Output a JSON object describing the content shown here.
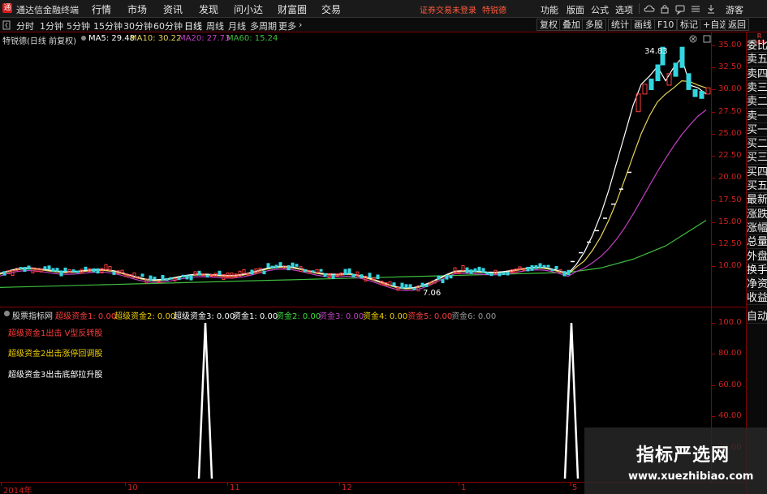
{
  "app": {
    "title": "通达信金融终端",
    "logo_char": "通"
  },
  "menu": [
    "行情",
    "市场",
    "资讯",
    "发现",
    "问小达",
    "财富圈",
    "交易"
  ],
  "status": {
    "trade_login": "证券交易未登录",
    "stock_name": "特锐德"
  },
  "right_menu": [
    "功能",
    "版面",
    "公式",
    "选项",
    "游客"
  ],
  "toolbar": {
    "periods": [
      "分时",
      "1分钟",
      "5分钟",
      "15分钟",
      "30分钟",
      "60分钟",
      "日线",
      "周线",
      "月线",
      "多周期",
      "更多"
    ],
    "active": "日线",
    "more_arrow": "›",
    "right_buttons": [
      "复权",
      "叠加",
      "多股",
      "统计",
      "画线",
      "F10",
      "标记",
      "+自选",
      "返回"
    ]
  },
  "chart_header": {
    "stock_label": "特锐德(日线 前复权)",
    "ma5_label": "MA5: 29.48",
    "ma10_label": "MA10: 30.22",
    "ma20_label": "MA20: 27.73",
    "ma60_label": "MA60: 15.24"
  },
  "colors": {
    "ma5": "#ffffff",
    "ma10": "#e8d35a",
    "ma20": "#c340c3",
    "ma60": "#3fbf3f",
    "up_candle": "#ff3c3c",
    "down_candle": "#33d6e0",
    "axis": "#d02020",
    "signal": "#ffffff"
  },
  "price_axis": {
    "min": 7.5,
    "max": 35,
    "ticks": [
      "35.00",
      "32.50",
      "30.00",
      "27.50",
      "25.00",
      "22.50",
      "20.00",
      "17.50",
      "15.00",
      "12.50",
      "10.00"
    ]
  },
  "annotations": {
    "high": "34.83",
    "low": "7.06"
  },
  "right_panel": [
    "委比",
    "卖五",
    "卖四",
    "卖三",
    "卖二",
    "卖一",
    "买一",
    "买二",
    "买三",
    "买四",
    "买五",
    "最新",
    "涨跌",
    "涨幅",
    "总量",
    "外盘",
    "换手",
    "净资",
    "收益",
    "自动"
  ],
  "right_panel_top": "R\n309",
  "indicator": {
    "name": "股票指标网",
    "labels": [
      {
        "text": "超级资金1: 0.00",
        "color": "#ff3c3c"
      },
      {
        "text": "超级资金2: 0.00",
        "color": "#f0d000"
      },
      {
        "text": "超级资金3: 0.00",
        "color": "#ffffff"
      },
      {
        "text": "资金1: 0.00",
        "color": "#ffffff"
      },
      {
        "text": "资金2: 0.00",
        "color": "#3fdf3f"
      },
      {
        "text": "资金3: 0.00",
        "color": "#c340c3"
      },
      {
        "text": "资金4: 0.00",
        "color": "#f0d000"
      },
      {
        "text": "资金5: 0.00",
        "color": "#ff3c3c"
      },
      {
        "text": "资金6: 0.00",
        "color": "#9a9a9a"
      }
    ],
    "notes": [
      {
        "text": "超级资金1出击 V型反转股",
        "color": "#ff3c3c"
      },
      {
        "text": "超级资金2出击涨停回调股",
        "color": "#f0d000"
      },
      {
        "text": "超级资金3出击底部拉升股",
        "color": "#ffffff"
      }
    ],
    "axis_ticks": [
      "100.0",
      "80.00",
      "60.00",
      "40.00",
      "20.00"
    ]
  },
  "chart_data": {
    "type": "line",
    "series": [
      {
        "name": "超级资金",
        "description_values": "two 100-level spikes, otherwise 0",
        "values": [
          0,
          100,
          0,
          100,
          0
        ]
      }
    ],
    "price_ma": {
      "MA5": 29.48,
      "MA10": 30.22,
      "MA20": 27.73,
      "MA60": 15.24
    },
    "ylim": [
      0,
      100
    ]
  },
  "date_axis": [
    "2014年",
    "10",
    "11",
    "12",
    "1",
    "5"
  ],
  "watermark": {
    "title": "指标严选网",
    "url": "www.xuezhibiao.com"
  }
}
